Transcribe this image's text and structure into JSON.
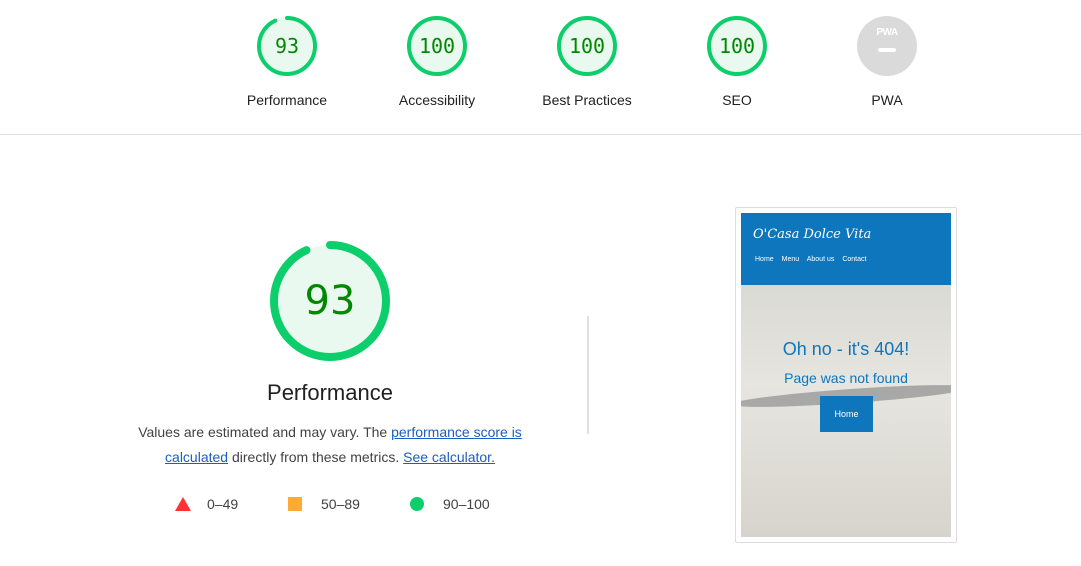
{
  "colors": {
    "pass": "#0cce6b",
    "pass_text": "#008800",
    "fail": "#ff3333",
    "average": "#ffaa33",
    "pwa": "#dadada",
    "link": "#1a5fc0",
    "site_blue": "#0e76bc"
  },
  "gauges": [
    {
      "score": "93",
      "label": "Performance",
      "fraction": 0.93
    },
    {
      "score": "100",
      "label": "Accessibility",
      "fraction": 1.0
    },
    {
      "score": "100",
      "label": "Best Practices",
      "fraction": 1.0
    },
    {
      "score": "100",
      "label": "SEO",
      "fraction": 1.0
    }
  ],
  "pwa": {
    "badge_text": "PWA",
    "label": "PWA",
    "icon": "pwa-badge-icon"
  },
  "performance": {
    "score": "93",
    "fraction": 0.93,
    "title": "Performance",
    "desc_prefix": "Values are estimated and may vary. The ",
    "link_score": "performance score is calculated",
    "desc_middle": " directly from these metrics. ",
    "link_calc": "See calculator."
  },
  "legend": [
    {
      "range": "0–49",
      "icon": "fail-triangle-icon"
    },
    {
      "range": "50–89",
      "icon": "average-square-icon"
    },
    {
      "range": "90–100",
      "icon": "pass-circle-icon"
    }
  ],
  "thumbnail": {
    "site_title": "O'Casa Dolce Vita",
    "nav": [
      "Home",
      "Menu",
      "About us",
      "Contact"
    ],
    "error_title": "Oh no - it's 404!",
    "error_sub": "Page was not found",
    "button": "Home"
  }
}
